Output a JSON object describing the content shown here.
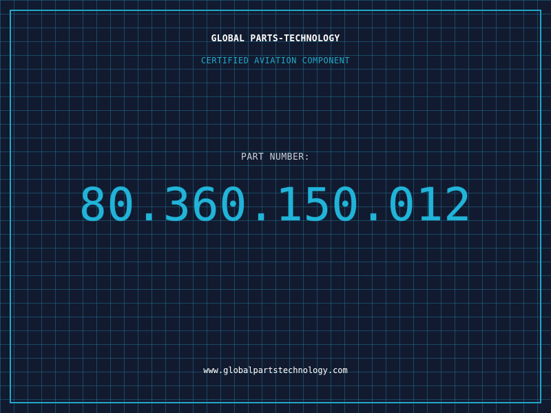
{
  "header": {
    "company": "GLOBAL PARTS-TECHNOLOGY",
    "tagline": "CERTIFIED AVIATION COMPONENT"
  },
  "part": {
    "label": "PART NUMBER:",
    "number": "80.360.150.012"
  },
  "footer": {
    "url": "www.globalpartstechnology.com"
  },
  "colors": {
    "background": "#111a2e",
    "accent": "#22a7c9",
    "grid": "#1e6e8c",
    "text": "#ffffff",
    "label": "#c9ced8"
  }
}
